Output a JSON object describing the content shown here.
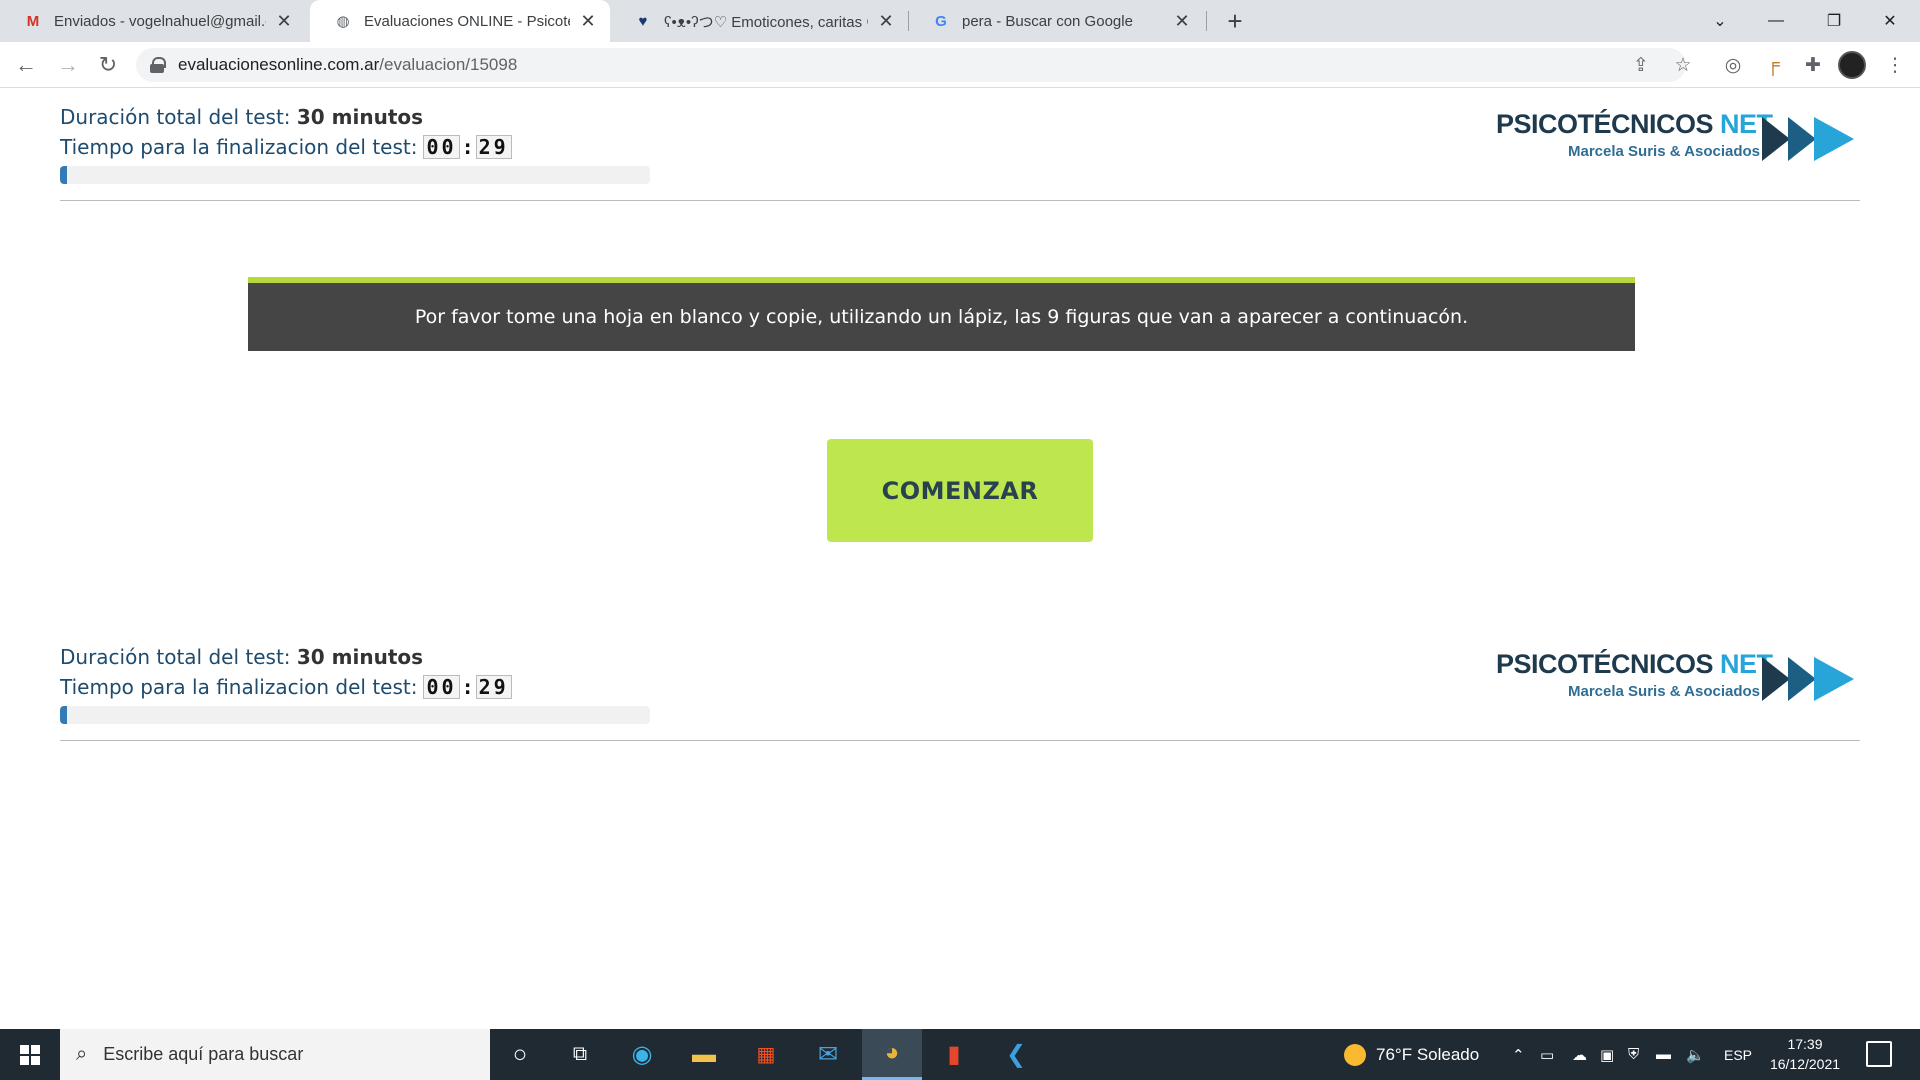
{
  "browser": {
    "tabs": [
      {
        "favicon": "gmail-icon",
        "title": "Enviados - vogelnahuel@gmail.com",
        "active": false
      },
      {
        "favicon": "globe-icon",
        "title": "Evaluaciones ONLINE - Psicotécnicos",
        "active": true
      },
      {
        "favicon": "heart-icon",
        "title": "ʕ•ᴥ•ʔつ♡ Emoticones, caritas 😛",
        "active": false
      },
      {
        "favicon": "google-icon",
        "title": "pera - Buscar con Google",
        "active": false
      }
    ],
    "new_tab_label": "+",
    "address": {
      "host": "evaluacionesonline.com.ar",
      "path": "/evaluacion/15098"
    }
  },
  "header": {
    "duration_label": "Duración total del test:",
    "duration_value": "30 minutos",
    "remaining_label": "Tiempo para la finalizacion del test:",
    "timer_minutes": "00",
    "timer_seconds": "29",
    "progress_fraction": 0.012
  },
  "logo": {
    "brand_main": "PSICOTÉCNICOS",
    "brand_accent": "NET",
    "subtitle": "Marcela Suris & Asociados"
  },
  "instruction_text": "Por favor tome una hoja en blanco y copie, utilizando un lápiz, las 9 figuras que van a aparecer a continuacón.",
  "start_button_label": "COMENZAR",
  "taskbar": {
    "search_placeholder": "Escribe aquí para buscar",
    "weather": "76°F  Soleado",
    "language": "ESP",
    "time": "17:39",
    "date": "16/12/2021"
  },
  "colors": {
    "accent_green": "#bde64f",
    "instruction_bg": "#454545",
    "instruction_border": "#b7d83a",
    "text_blue": "#1e4b6e",
    "progress_fill": "#337ab7",
    "brand_accent": "#27a4d8"
  }
}
